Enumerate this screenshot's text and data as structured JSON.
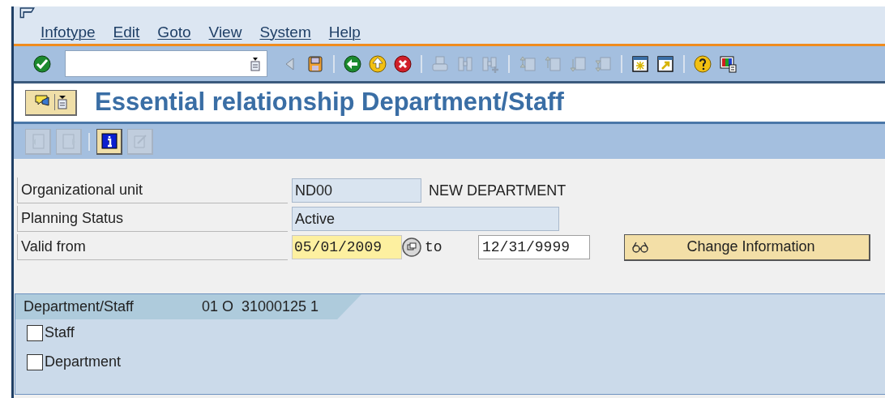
{
  "menu_bar": {
    "items": [
      "Infotype",
      "Edit",
      "Goto",
      "View",
      "System",
      "Help"
    ]
  },
  "standard_toolbar": {
    "buttons": [
      {
        "kind": "enter",
        "disabled": false
      },
      {
        "kind": "command-field"
      },
      {
        "kind": "back-arrow",
        "disabled": true
      },
      {
        "kind": "save",
        "disabled": false
      },
      {
        "kind": "separator"
      },
      {
        "kind": "back",
        "disabled": false
      },
      {
        "kind": "exit",
        "disabled": false
      },
      {
        "kind": "cancel",
        "disabled": false
      },
      {
        "kind": "separator"
      },
      {
        "kind": "print",
        "disabled": true
      },
      {
        "kind": "find",
        "disabled": true
      },
      {
        "kind": "find-next",
        "disabled": true
      },
      {
        "kind": "separator"
      },
      {
        "kind": "first-page",
        "disabled": true
      },
      {
        "kind": "prev-page",
        "disabled": true
      },
      {
        "kind": "next-page",
        "disabled": true
      },
      {
        "kind": "last-page",
        "disabled": true
      },
      {
        "kind": "separator"
      },
      {
        "kind": "new-session",
        "disabled": false
      },
      {
        "kind": "shortcut",
        "disabled": false
      },
      {
        "kind": "separator"
      },
      {
        "kind": "help",
        "disabled": false
      },
      {
        "kind": "layout",
        "disabled": false
      }
    ]
  },
  "title_bar": {
    "title": "Essential relationship Department/Staff"
  },
  "application_toolbar": {
    "buttons": [
      {
        "kind": "previous",
        "disabled": true
      },
      {
        "kind": "next",
        "disabled": true
      },
      {
        "kind": "separator"
      },
      {
        "kind": "info",
        "disabled": false
      },
      {
        "kind": "change",
        "disabled": true
      }
    ]
  },
  "form": {
    "org_unit": {
      "label": "Organizational unit",
      "value": "ND00",
      "description": "NEW DEPARTMENT"
    },
    "planning_status": {
      "label": "Planning Status",
      "value": "Active"
    },
    "validity": {
      "label": "Valid from",
      "from": "05/01/2009",
      "to_label": "to",
      "to": "12/31/9999"
    },
    "change_information_button": "Change Information"
  },
  "group_box": {
    "title": "Department/Staff",
    "key": "01 O  31000125 1",
    "checkboxes": [
      {
        "label": "Staff",
        "checked": false
      },
      {
        "label": "Department",
        "checked": false
      }
    ]
  }
}
